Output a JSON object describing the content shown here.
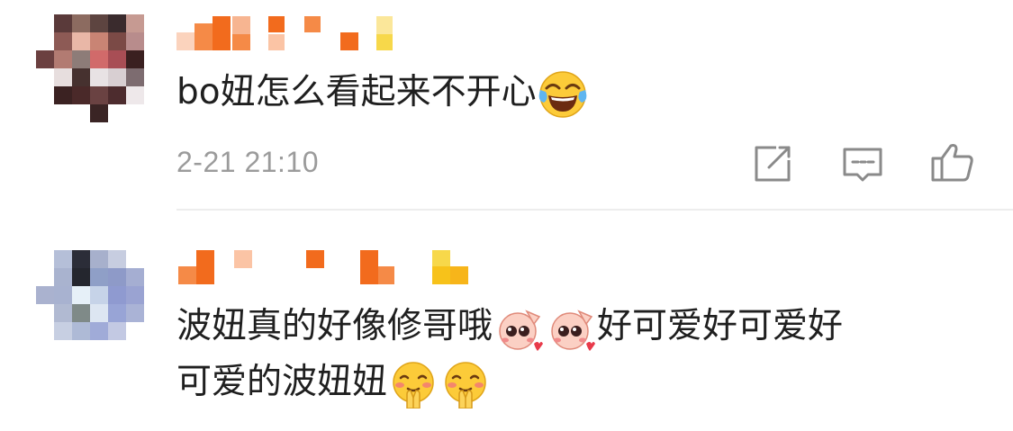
{
  "comments": [
    {
      "username": "",
      "text": "bo妞怎么看起来不开心",
      "emojis": [
        "face-with-tears-of-joy-icon"
      ],
      "timestamp": "2-21 21:10",
      "actions": [
        "share-icon",
        "comment-icon",
        "like-icon"
      ]
    },
    {
      "username": "",
      "text_line1": "波妞真的好像修哥哦",
      "text_line1_tail": "好可爱好可爱好",
      "text_line2": "可爱的波妞妞",
      "emojis_line1": [
        "cute-face-sticker-icon",
        "cute-face-sticker-icon"
      ],
      "emojis_line2": [
        "blushing-praying-face-icon",
        "blushing-praying-face-icon"
      ]
    }
  ],
  "colors": {
    "text": "#1f1f1f",
    "meta": "#9b9b9b",
    "icon": "#8a8a8a",
    "divider": "#ededed",
    "mosaic_orange": "#f26b1d",
    "mosaic_yellow": "#f7c21a"
  }
}
